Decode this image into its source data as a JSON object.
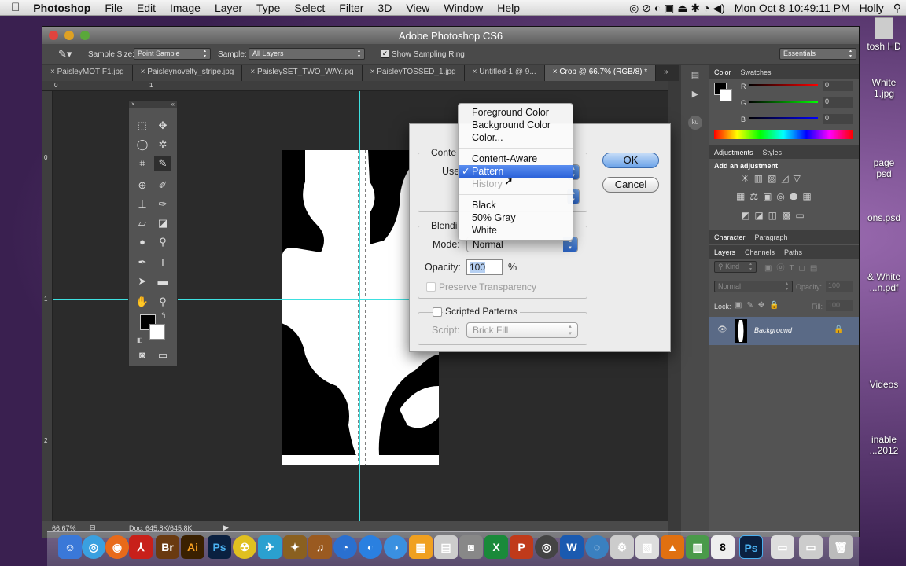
{
  "menubar": {
    "app": "Photoshop",
    "items": [
      "File",
      "Edit",
      "Image",
      "Layer",
      "Type",
      "Select",
      "Filter",
      "3D",
      "View",
      "Window",
      "Help"
    ],
    "clock": "Mon Oct 8  10:49:11 PM",
    "user": "Holly"
  },
  "desktop": {
    "icons": [
      "tosh HD",
      "White\n1.jpg",
      "page\npsd",
      "ons.psd",
      "& White\n...n.pdf",
      "Videos",
      "inable\n...2012"
    ]
  },
  "window": {
    "title": "Adobe Photoshop CS6"
  },
  "options": {
    "sample_size_label": "Sample Size:",
    "sample_size_value": "Point Sample",
    "sample_label": "Sample:",
    "sample_value": "All Layers",
    "show_ring_label": "Show Sampling Ring",
    "workspace": "Essentials"
  },
  "tabs": [
    "PaisleyMOTIF1.jpg",
    "Paisleynovelty_stripe.jpg",
    "PaisleySET_TWO_WAY.jpg",
    "PaisleyTOSSED_1.jpg",
    "Untitled-1 @ 9...",
    "Crop @ 66.7% (RGB/8) *"
  ],
  "tabs_more": "»",
  "ruler": {
    "h0": "0",
    "h1": "1",
    "v0": "0",
    "v1": "1",
    "v2": "2"
  },
  "status": {
    "zoom": "66.67%",
    "doc": "Doc: 645.8K/645.8K"
  },
  "color_panel": {
    "tabs": [
      "Color",
      "Swatches"
    ],
    "r_label": "R",
    "g_label": "G",
    "b_label": "B",
    "r": "0",
    "g": "0",
    "b": "0"
  },
  "adjust_panel": {
    "tabs": [
      "Adjustments",
      "Styles"
    ],
    "heading": "Add an adjustment"
  },
  "char_panel": {
    "tabs": [
      "Character",
      "Paragraph"
    ]
  },
  "layers_panel": {
    "tabs": [
      "Layers",
      "Channels",
      "Paths"
    ],
    "kind": "Kind",
    "blend": "Normal",
    "opacity_label": "Opacity:",
    "opacity": "100",
    "lock_label": "Lock:",
    "fill_label": "Fill:",
    "fill": "100",
    "layer_name": "Background"
  },
  "dialog": {
    "contents_label": "Conte",
    "use_label": "Use",
    "blending_label": "Blendi",
    "mode_label": "Mode:",
    "mode_value": "Normal",
    "opacity_label": "Opacity:",
    "opacity_value": "100",
    "percent": "%",
    "preserve_label": "Preserve Transparency",
    "scripted_label": "Scripted Patterns",
    "script_label": "Script:",
    "script_value": "Brick Fill",
    "ok": "OK",
    "cancel": "Cancel"
  },
  "menu": {
    "items": [
      "Foreground Color",
      "Background Color",
      "Color...",
      "Content-Aware",
      "Pattern",
      "History",
      "Black",
      "50% Gray",
      "White"
    ],
    "checkmark": "✓"
  },
  "dock": {
    "labels": [
      "Br",
      "Ai",
      "Ps",
      "W",
      "Ps"
    ]
  },
  "colors": {
    "accent": "#2b62d9",
    "guide": "#3ee0e0"
  }
}
